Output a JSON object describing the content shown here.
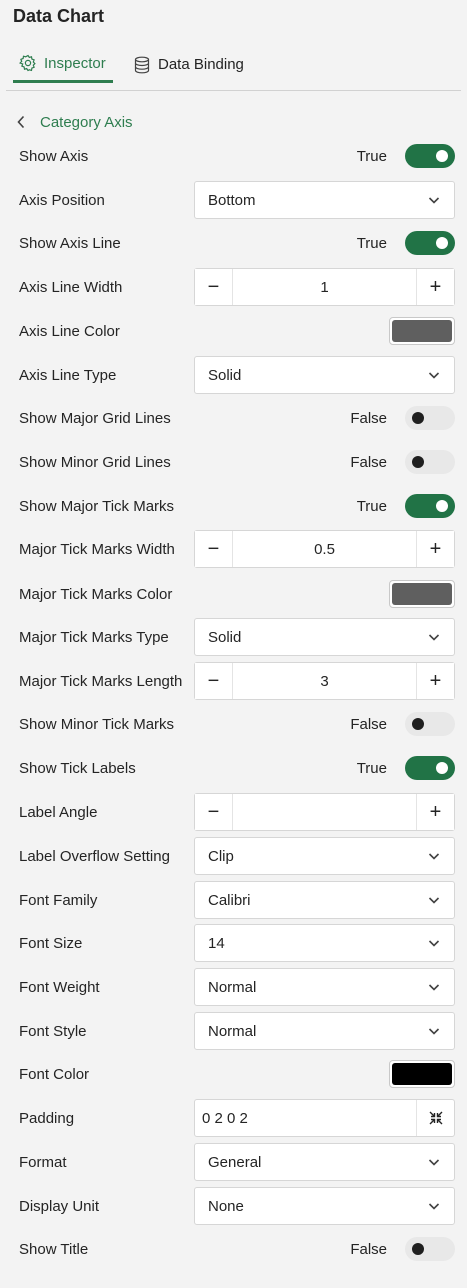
{
  "app": {
    "title": "Data Chart"
  },
  "tabs": [
    {
      "label": "Inspector",
      "active": true,
      "icon": "gear-icon"
    },
    {
      "label": "Data Binding",
      "active": false,
      "icon": "database-icon"
    }
  ],
  "colors": {
    "accent": "#2e7d4f",
    "toggle_on": "#217346"
  },
  "section": {
    "back_label": "Category Axis"
  },
  "props": {
    "show_axis": {
      "label": "Show Axis",
      "value": "True",
      "on": true
    },
    "axis_position": {
      "label": "Axis Position",
      "value": "Bottom"
    },
    "show_axis_line": {
      "label": "Show Axis Line",
      "value": "True",
      "on": true
    },
    "axis_line_width": {
      "label": "Axis Line Width",
      "value": "1",
      "minus": "−",
      "plus": "+"
    },
    "axis_line_color": {
      "label": "Axis Line Color",
      "color": "#5f5f5f"
    },
    "axis_line_type": {
      "label": "Axis Line Type",
      "value": "Solid"
    },
    "show_major_grid": {
      "label": "Show Major Grid Lines",
      "value": "False",
      "on": false
    },
    "show_minor_grid": {
      "label": "Show Minor Grid Lines",
      "value": "False",
      "on": false
    },
    "show_major_ticks": {
      "label": "Show Major Tick Marks",
      "value": "True",
      "on": true
    },
    "major_ticks_width": {
      "label": "Major Tick Marks Width",
      "value": "0.5",
      "minus": "−",
      "plus": "+"
    },
    "major_ticks_color": {
      "label": "Major Tick Marks Color",
      "color": "#5f5f5f"
    },
    "major_ticks_type": {
      "label": "Major Tick Marks Type",
      "value": "Solid"
    },
    "major_ticks_length": {
      "label": "Major Tick Marks Length",
      "value": "3",
      "minus": "−",
      "plus": "+"
    },
    "show_minor_ticks": {
      "label": "Show Minor Tick Marks",
      "value": "False",
      "on": false
    },
    "show_tick_labels": {
      "label": "Show Tick Labels",
      "value": "True",
      "on": true
    },
    "label_angle": {
      "label": "Label Angle",
      "value": "",
      "minus": "−",
      "plus": "+"
    },
    "label_overflow": {
      "label": "Label Overflow Setting",
      "value": "Clip"
    },
    "font_family": {
      "label": "Font Family",
      "value": "Calibri"
    },
    "font_size": {
      "label": "Font Size",
      "value": "14"
    },
    "font_weight": {
      "label": "Font Weight",
      "value": "Normal"
    },
    "font_style": {
      "label": "Font Style",
      "value": "Normal"
    },
    "font_color": {
      "label": "Font Color",
      "color": "#000000"
    },
    "padding": {
      "label": "Padding",
      "value": "0 2 0 2",
      "icon": "collapse-arrows-icon"
    },
    "format": {
      "label": "Format",
      "value": "General"
    },
    "display_unit": {
      "label": "Display Unit",
      "value": "None"
    },
    "show_title": {
      "label": "Show Title",
      "value": "False",
      "on": false
    }
  }
}
